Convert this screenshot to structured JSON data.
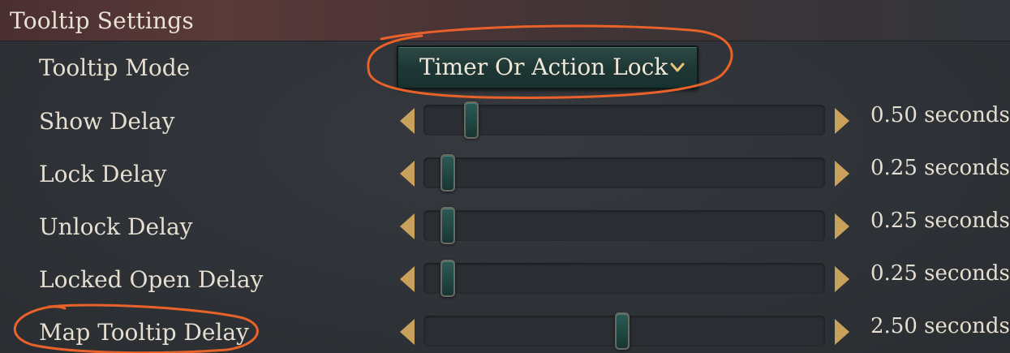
{
  "header": {
    "title": "Tooltip Settings"
  },
  "tooltip_mode": {
    "label": "Tooltip Mode",
    "selected": "Timer Or Action Lock"
  },
  "sliders": [
    {
      "label": "Show Delay",
      "value_text": "0.50 seconds",
      "fraction": 0.12
    },
    {
      "label": "Lock Delay",
      "value_text": "0.25 seconds",
      "fraction": 0.06
    },
    {
      "label": "Unlock Delay",
      "value_text": "0.25 seconds",
      "fraction": 0.06
    },
    {
      "label": "Locked Open Delay",
      "value_text": "0.25 seconds",
      "fraction": 0.06
    },
    {
      "label": "Map Tooltip Delay",
      "value_text": "2.50 seconds",
      "fraction": 0.495
    }
  ],
  "colors": {
    "annotation": "#e8622a",
    "arrow": "#c9a15a"
  }
}
